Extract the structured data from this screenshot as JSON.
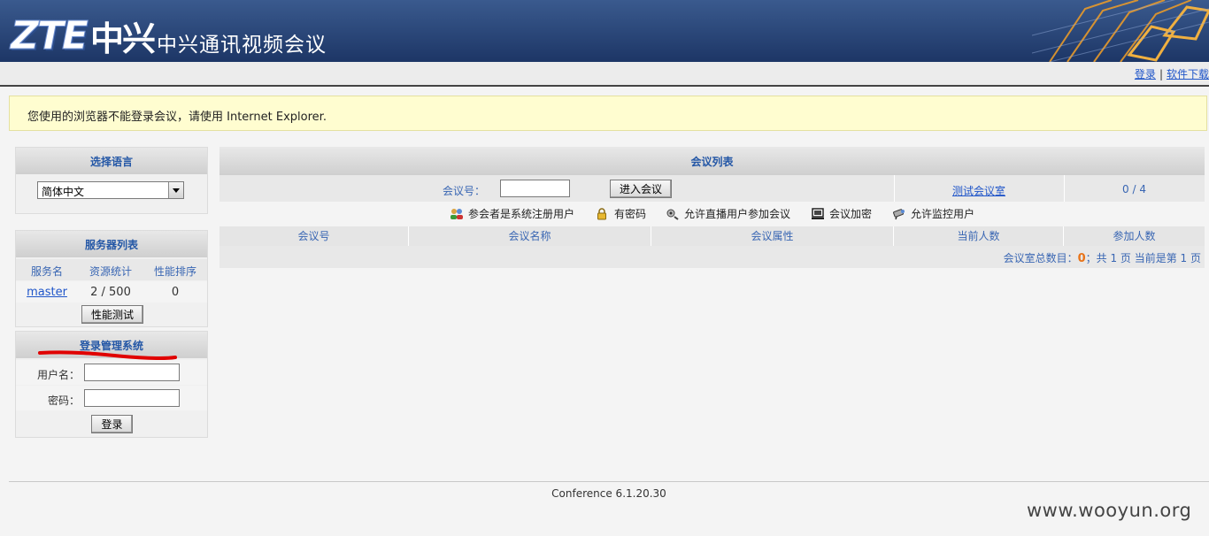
{
  "header": {
    "logo_latin": "ZTE",
    "logo_cn": "中兴",
    "title": "中兴通讯视频会议"
  },
  "toplinks": {
    "login": "登录",
    "separator": "|",
    "download": "软件下载"
  },
  "warning": "您使用的浏览器不能登录会议，请使用 Internet Explorer.",
  "language_panel": {
    "title": "选择语言",
    "selected": "简体中文"
  },
  "server_panel": {
    "title": "服务器列表",
    "columns": [
      "服务名",
      "资源统计",
      "性能排序"
    ],
    "rows": [
      {
        "name": "master",
        "resources": "2 / 500",
        "rank": "0"
      }
    ],
    "perf_test_button": "性能测试"
  },
  "login_panel": {
    "title": "登录管理系统",
    "username_label": "用户名：",
    "password_label": "密码：",
    "username_value": "",
    "password_value": "",
    "login_button": "登录"
  },
  "conference_panel": {
    "title": "会议列表",
    "conf_no_label": "会议号：",
    "conf_no_value": "",
    "enter_button": "进入会议",
    "test_room_link": "测试会议室",
    "test_room_count": "0 / 4",
    "legend": [
      {
        "icon": "registered-users-icon",
        "label": "参会者是系统注册用户"
      },
      {
        "icon": "lock-icon",
        "label": "有密码"
      },
      {
        "icon": "broadcast-icon",
        "label": "允许直播用户参加会议"
      },
      {
        "icon": "encryption-monitor-icon",
        "label": "会议加密"
      },
      {
        "icon": "camera-icon",
        "label": "允许监控用户"
      }
    ],
    "columns": [
      "会议号",
      "会议名称",
      "会议属性",
      "当前人数",
      "参加人数"
    ],
    "summary": {
      "prefix": "会议室总数目：",
      "total": "0",
      "middle": "；共 1 页 当前是第 1 页"
    }
  },
  "footer": {
    "version": "Conference 6.1.20.30",
    "watermark": "www.wooyun.org"
  },
  "colors": {
    "header_blue": "#1d3666",
    "link_blue": "#1f55c9",
    "warning_bg": "#fffdd0",
    "accent_orange": "#e8741a",
    "annotation_red": "#e00000"
  }
}
